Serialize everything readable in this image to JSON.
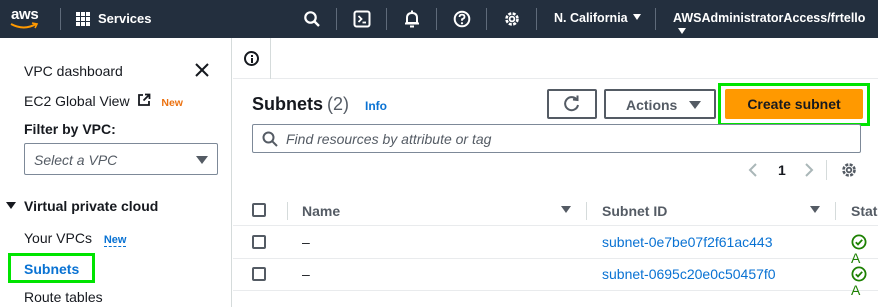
{
  "topbar": {
    "logo_text": "aws",
    "services_label": "Services",
    "region_label": "N. California",
    "account_label": "AWSAdministratorAccess/frtello",
    "icons": [
      "search-icon",
      "cloudshell-icon",
      "notifications-bell-icon",
      "help-icon",
      "settings-gear-icon"
    ]
  },
  "sidebar": {
    "vpc_dashboard": "VPC dashboard",
    "ec2_global_view": "EC2 Global View",
    "new_badge": "New",
    "filter_label": "Filter by VPC:",
    "filter_placeholder": "Select a VPC",
    "section_title": "Virtual private cloud",
    "your_vpcs": "Your VPCs",
    "your_vpcs_badge": "New",
    "subnets": "Subnets",
    "route_tables": "Route tables"
  },
  "main": {
    "title": "Subnets",
    "count": "(2)",
    "info_link": "Info",
    "actions_label": "Actions",
    "create_label": "Create subnet",
    "search_placeholder": "Find resources by attribute or tag",
    "page_number": "1",
    "columns": [
      "Name",
      "Subnet ID",
      "Stat"
    ],
    "rows": [
      {
        "name": "–",
        "subnet_id": "subnet-0e7be07f2f61ac443",
        "status": "A"
      },
      {
        "name": "–",
        "subnet_id": "subnet-0695c20e0c50457f0",
        "status": "A"
      }
    ]
  },
  "colors": {
    "topbar_bg": "#232f3e",
    "primary_button": "#ff9900",
    "link": "#0972d3",
    "highlight": "#00e400",
    "status_ok": "#1d8102"
  }
}
